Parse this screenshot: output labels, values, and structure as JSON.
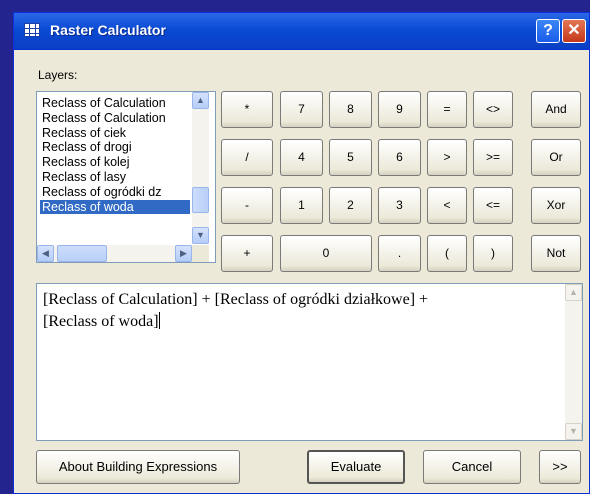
{
  "window": {
    "title": "Raster Calculator",
    "help_label": "?",
    "close_label": "✕"
  },
  "layers": {
    "label": "Layers:",
    "items": [
      "Reclass of Calculation",
      "Reclass of Calculation",
      "Reclass of ciek",
      "Reclass of drogi",
      "Reclass of kolej",
      "Reclass of lasy",
      "Reclass of ogródki dz",
      "Reclass of woda"
    ],
    "selected": "Reclass of woda"
  },
  "buttons": {
    "multiply": "*",
    "divide": "/",
    "minus": "-",
    "plus": "+",
    "n7": "7",
    "n8": "8",
    "n9": "9",
    "n4": "4",
    "n5": "5",
    "n6": "6",
    "n1": "1",
    "n2": "2",
    "n3": "3",
    "n0": "0",
    "dot": ".",
    "eq": "=",
    "neq": "<>",
    "gt": ">",
    "gte": ">=",
    "lt": "<",
    "lte": "<=",
    "lparen": "(",
    "rparen": ")",
    "and": "And",
    "or": "Or",
    "xor": "Xor",
    "not": "Not"
  },
  "expression": {
    "line1": "[Reclass of Calculation]  + [Reclass of ogródki działkowe]  +",
    "line2": "[Reclass of woda]"
  },
  "footer": {
    "about": "About Building Expressions",
    "evaluate": "Evaluate",
    "cancel": "Cancel",
    "more": ">>"
  }
}
